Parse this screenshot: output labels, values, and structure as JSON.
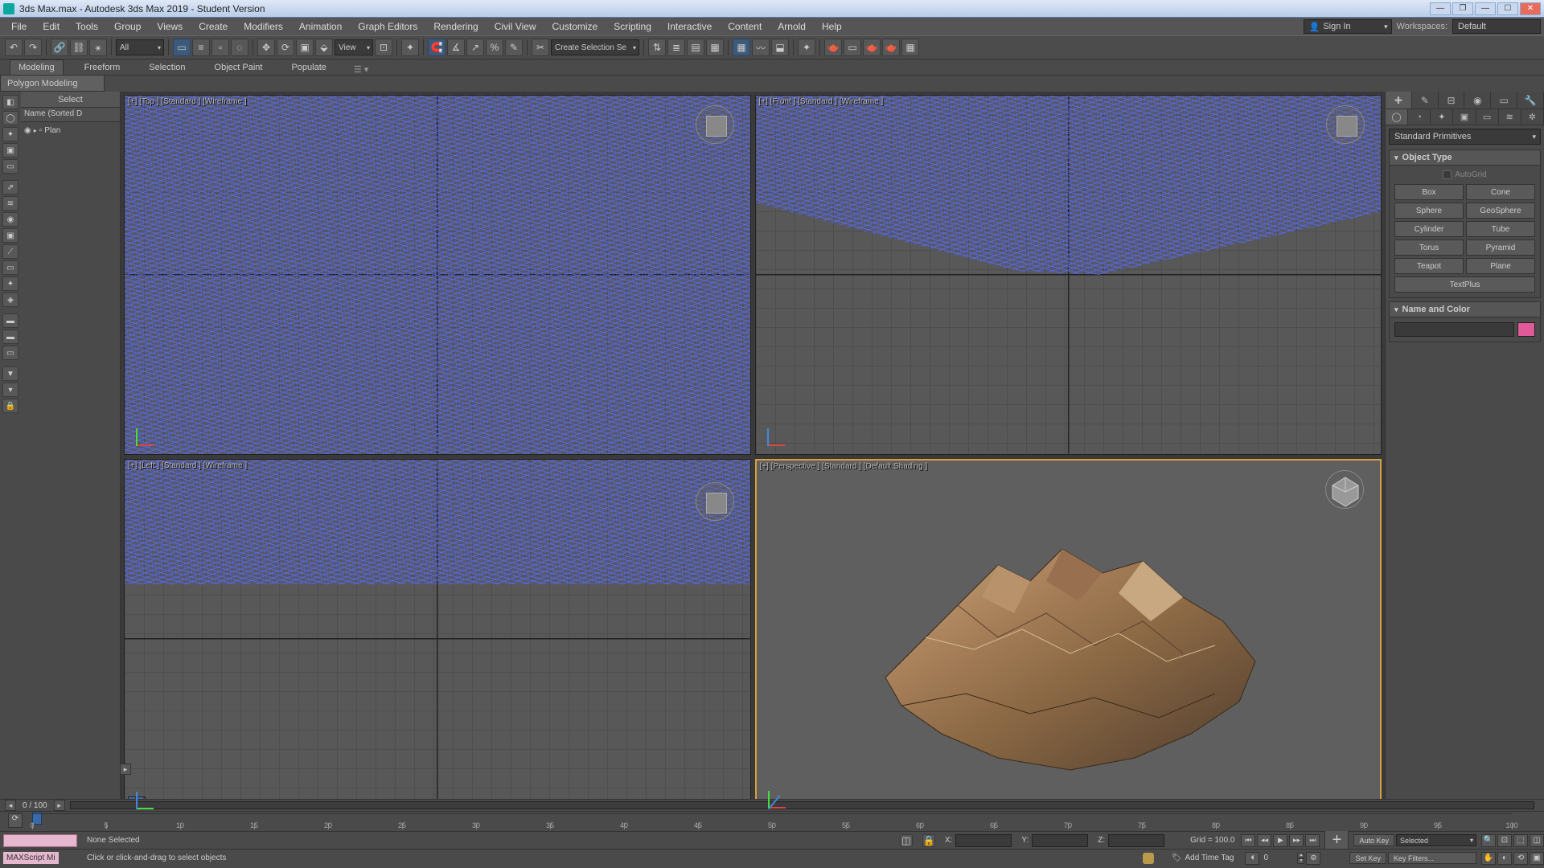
{
  "title": "3ds Max.max - Autodesk 3ds Max 2019 - Student Version",
  "menu": [
    "File",
    "Edit",
    "Tools",
    "Group",
    "Views",
    "Create",
    "Modifiers",
    "Animation",
    "Graph Editors",
    "Rendering",
    "Civil View",
    "Customize",
    "Scripting",
    "Interactive",
    "Content",
    "Arnold",
    "Help"
  ],
  "signin": "Sign In",
  "workspaces_label": "Workspaces:",
  "workspace": "Default",
  "toolbar": {
    "filter": "All",
    "view": "View",
    "selset": "Create Selection Se"
  },
  "ribbon": {
    "tabs": [
      "Modeling",
      "Freeform",
      "Selection",
      "Object Paint",
      "Populate"
    ],
    "sub": "Polygon Modeling"
  },
  "scene": {
    "select": "Select",
    "col": "Name (Sorted D",
    "item": "Plan"
  },
  "viewports": {
    "tl": "[+] [Top ] [Standard ] [Wireframe ]",
    "tr": "[+] [Front ] [Standard ] [Wireframe ]",
    "bl": "[+] [Left ] [Standard ] [Wireframe ]",
    "br": "[+] [Perspective ] [Standard ] [Default Shading ]"
  },
  "cmd": {
    "dropdown": "Standard Primitives",
    "objtype": "Object Type",
    "autogrid": "AutoGrid",
    "prims": [
      "Box",
      "Cone",
      "Sphere",
      "GeoSphere",
      "Cylinder",
      "Tube",
      "Torus",
      "Pyramid",
      "Teapot",
      "Plane",
      "TextPlus"
    ],
    "namecolor": "Name and Color"
  },
  "timeline": {
    "frame": "0 / 100",
    "ticks": [
      0,
      5,
      10,
      15,
      20,
      25,
      30,
      35,
      40,
      45,
      50,
      55,
      60,
      65,
      70,
      75,
      80,
      85,
      90,
      95,
      100
    ]
  },
  "status": {
    "maxscript": "MAXScript Mi",
    "none": "None Selected",
    "prompt": "Click or click-and-drag to select objects",
    "x": "X:",
    "y": "Y:",
    "z": "Z:",
    "grid": "Grid = 100.0",
    "addtag": "Add Time Tag",
    "autokey": "Auto Key",
    "setkey": "Set Key",
    "selected": "Selected",
    "keyfilters": "Key Filters...",
    "spin": "0"
  }
}
